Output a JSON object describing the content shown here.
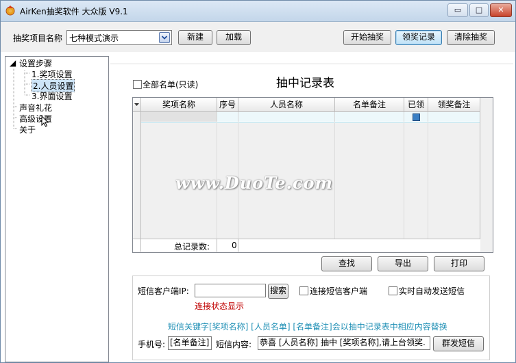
{
  "window": {
    "title": "AirKen抽奖软件 大众版 V9.1",
    "min": "▭",
    "max": "□",
    "close": "✕"
  },
  "toolbar": {
    "project_label": "抽奖项目名称",
    "project_value": "七种模式演示",
    "new_label": "新建",
    "load_label": "加载",
    "start_label": "开始抽奖",
    "records_label": "领奖记录",
    "clear_label": "清除抽奖"
  },
  "tree": {
    "root": "设置步骤",
    "children": [
      "1.奖项设置",
      "2.人员设置",
      "3.界面设置"
    ],
    "others": [
      "声音礼花",
      "高级设置",
      "关于"
    ]
  },
  "main": {
    "all_list_label": "全部名单(只读)",
    "title": "抽中记录表",
    "columns": [
      "奖项名称",
      "序号",
      "人员名称",
      "名单备注",
      "已领",
      "领奖备注"
    ],
    "total_label": "总记录数:",
    "total_value": "0",
    "search_label": "查找",
    "export_label": "导出",
    "print_label": "打印"
  },
  "watermark": "www.DuoTe.com",
  "sms": {
    "ip_label": "短信客户端IP:",
    "ip_value": "",
    "search_label": "搜索",
    "connect_label": "连接短信客户端",
    "auto_label": "实时自动发送短信",
    "status_text": "连接状态显示",
    "hint": "短信关键字[奖项名称] [人员名单] [名单备注]会以抽中记录表中相应内容替换",
    "phone_label": "手机号:",
    "phone_value": "[名单备注]",
    "content_label": "短信内容:",
    "content_value": "恭喜 [人员名称] 抽中 [奖项名称],请上台领奖.",
    "send_label": "群发短信"
  },
  "colors": {
    "status": "#c00000",
    "hint": "#1f8fb5",
    "window_border": "#6e8aa8"
  }
}
